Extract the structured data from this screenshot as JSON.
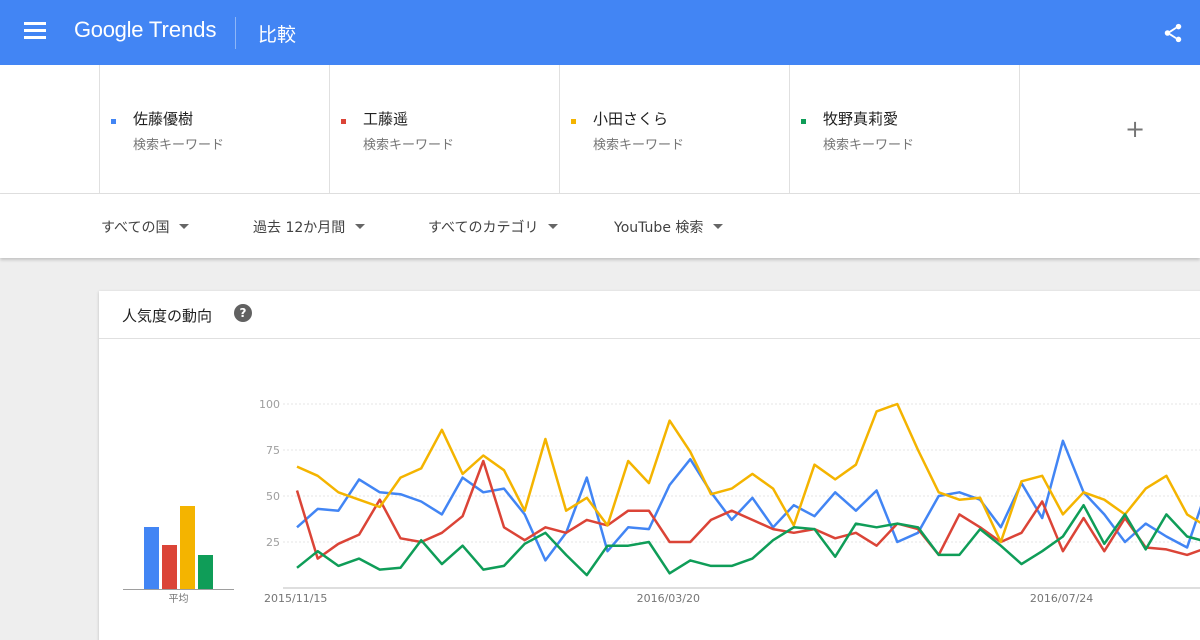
{
  "header": {
    "logo_google": "Google",
    "logo_trends": "Trends",
    "page_title": "比較",
    "bg_color": "#4285f4",
    "icons": [
      "menu-icon",
      "share-icon"
    ]
  },
  "terms": [
    {
      "name": "佐藤優樹",
      "type": "検索キーワード",
      "color": "#4285f4"
    },
    {
      "name": "工藤遥",
      "type": "検索キーワード",
      "color": "#db4437"
    },
    {
      "name": "小田さくら",
      "type": "検索キーワード",
      "color": "#f4b400"
    },
    {
      "name": "牧野真莉愛",
      "type": "検索キーワード",
      "color": "#0f9d58"
    }
  ],
  "add_term": "+",
  "filters": {
    "region": "すべての国",
    "period": "過去 12か月間",
    "category": "すべてのカテゴリ",
    "search_type": "YouTube 検索"
  },
  "card": {
    "title": "人気度の動向",
    "help": "?",
    "average_label": "平均"
  },
  "chart_data": {
    "type": "line",
    "ylim": [
      0,
      100
    ],
    "y_ticks": [
      "100",
      "75",
      "50",
      "25"
    ],
    "x_ticks": [
      "2015/11/15",
      "2016/03/20",
      "2016/07/24"
    ],
    "average": [
      42,
      30,
      56,
      23
    ],
    "series": [
      {
        "name": "佐藤優樹",
        "color": "#4285f4",
        "values": [
          33,
          43,
          42,
          59,
          52,
          51,
          47,
          40,
          60,
          52,
          54,
          40,
          15,
          30,
          60,
          20,
          33,
          32,
          56,
          70,
          52,
          37,
          49,
          33,
          45,
          39,
          52,
          42,
          53,
          25,
          30,
          50,
          52,
          48,
          33,
          57,
          38,
          80,
          52,
          40,
          25,
          35,
          28,
          22,
          55,
          40,
          38,
          33,
          40,
          58,
          40,
          44
        ]
      },
      {
        "name": "工藤遥",
        "color": "#db4437",
        "values": [
          53,
          16,
          24,
          29,
          48,
          27,
          25,
          30,
          39,
          69,
          33,
          26,
          33,
          30,
          37,
          34,
          42,
          42,
          25,
          25,
          37,
          42,
          37,
          32,
          30,
          32,
          27,
          30,
          23,
          35,
          32,
          18,
          40,
          33,
          25,
          30,
          47,
          20,
          38,
          20,
          38,
          22,
          21,
          18,
          22,
          19,
          19,
          15,
          23,
          27,
          35,
          20,
          38
        ]
      },
      {
        "name": "小田さくら",
        "color": "#f4b400",
        "values": [
          66,
          61,
          52,
          48,
          44,
          60,
          65,
          86,
          62,
          72,
          64,
          42,
          81,
          42,
          49,
          34,
          69,
          57,
          91,
          74,
          51,
          54,
          62,
          54,
          34,
          67,
          59,
          67,
          96,
          100,
          75,
          52,
          48,
          49,
          25,
          58,
          61,
          40,
          52,
          48,
          40,
          54,
          61,
          40,
          33,
          52,
          35,
          41,
          34,
          45,
          34,
          58,
          63
        ]
      },
      {
        "name": "牧野真莉愛",
        "color": "#0f9d58",
        "values": [
          11,
          20,
          12,
          16,
          10,
          11,
          26,
          13,
          23,
          10,
          12,
          24,
          30,
          18,
          7,
          23,
          23,
          25,
          8,
          15,
          12,
          12,
          16,
          26,
          33,
          32,
          17,
          35,
          33,
          35,
          33,
          18,
          18,
          32,
          23,
          13,
          20,
          28,
          45,
          24,
          40,
          21,
          40,
          28,
          25,
          37,
          26,
          30,
          14,
          24,
          23,
          30,
          28
        ]
      }
    ]
  }
}
